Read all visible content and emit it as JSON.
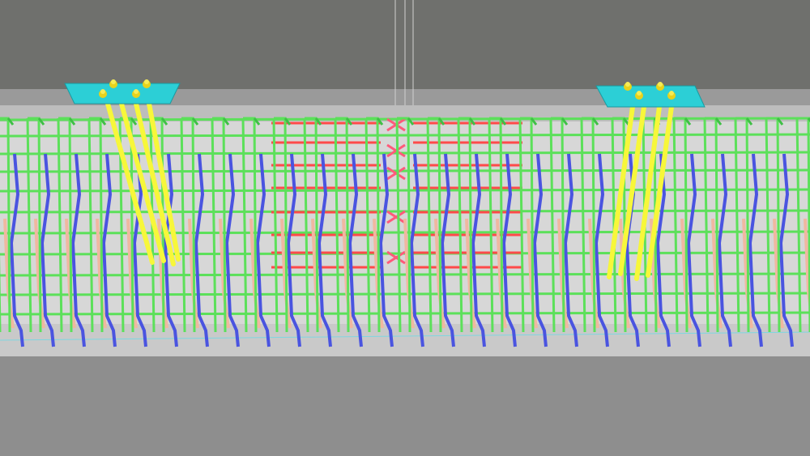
{
  "viewer": {
    "colors": {
      "background_wall": "#6f706d",
      "top_slab": "#9a9a9a",
      "beam_face": "#d7d7d7",
      "beam_bottom": "#c9c9c9",
      "floor": "#8e8e8e",
      "stirrup": "#5ce05a",
      "stirrup_dark": "#3fbf46",
      "longitudinal_bar": "#4a54e0",
      "dowel_bar": "#f0b8a0",
      "cross_bar": "#ff4a4a",
      "cross_tie": "#ff5a7a",
      "anchor_bolt": "#f7f73a",
      "base_plate": "#2ccfd6",
      "nut": "#e8d21c",
      "joint_line": "#d0d0d0"
    }
  }
}
